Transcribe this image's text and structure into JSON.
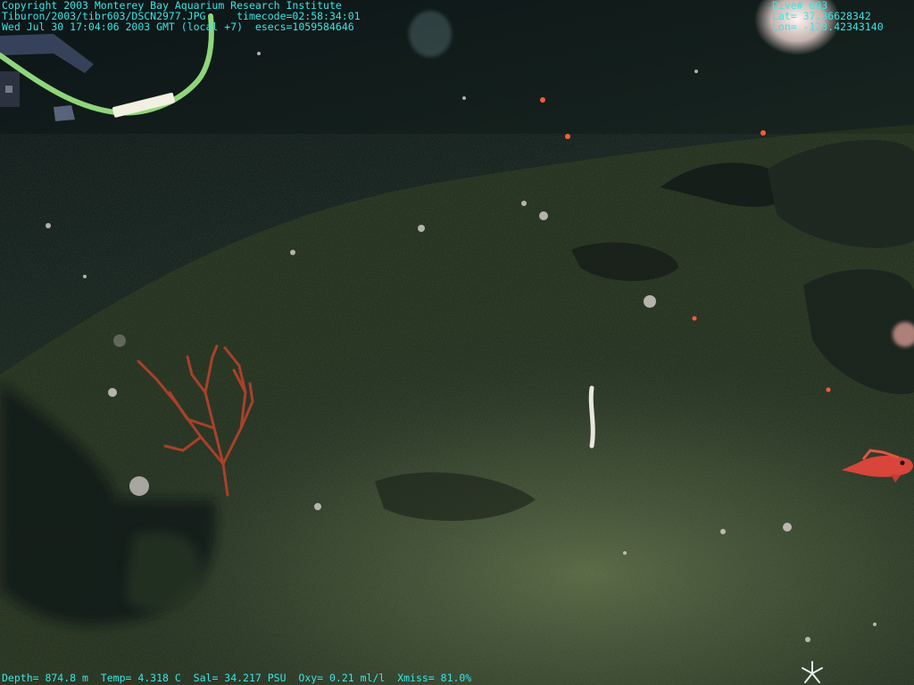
{
  "overlay": {
    "copyright": "Copyright 2003 Monterey Bay Aquarium Research Institute",
    "file_path": "Tiburon/2003/tibr603/DSCN2977.JPG",
    "timecode": "timecode=02:58:34:01",
    "datetime": "Wed Jul 30 17:04:06 2003 GMT (local +7)",
    "esecs": "esecs=1059584646",
    "dive": "Dive# 603",
    "lat": "Lat= 37.36628342",
    "lon": "Lon= -123.42343140",
    "depth": "Depth= 874.8 m",
    "temp": "Temp= 4.318 C",
    "sal": "Sal= 34.217 PSU",
    "oxy": "Oxy= 0.21 ml/l",
    "xmiss": "Xmiss= 81.0%"
  },
  "colors": {
    "overlay_text": "#37e6e6",
    "water": "#0f1a1c",
    "sediment": "#4a5a3a",
    "coral": "#a8412a",
    "rockfish": "#d8453a",
    "cable": "#8fd67a"
  },
  "scene": {
    "subjects": [
      "deep-sea sediment slope",
      "red gorgonian coral",
      "red rockfish",
      "sea pen",
      "vehicle cable",
      "vehicle shadow"
    ]
  }
}
